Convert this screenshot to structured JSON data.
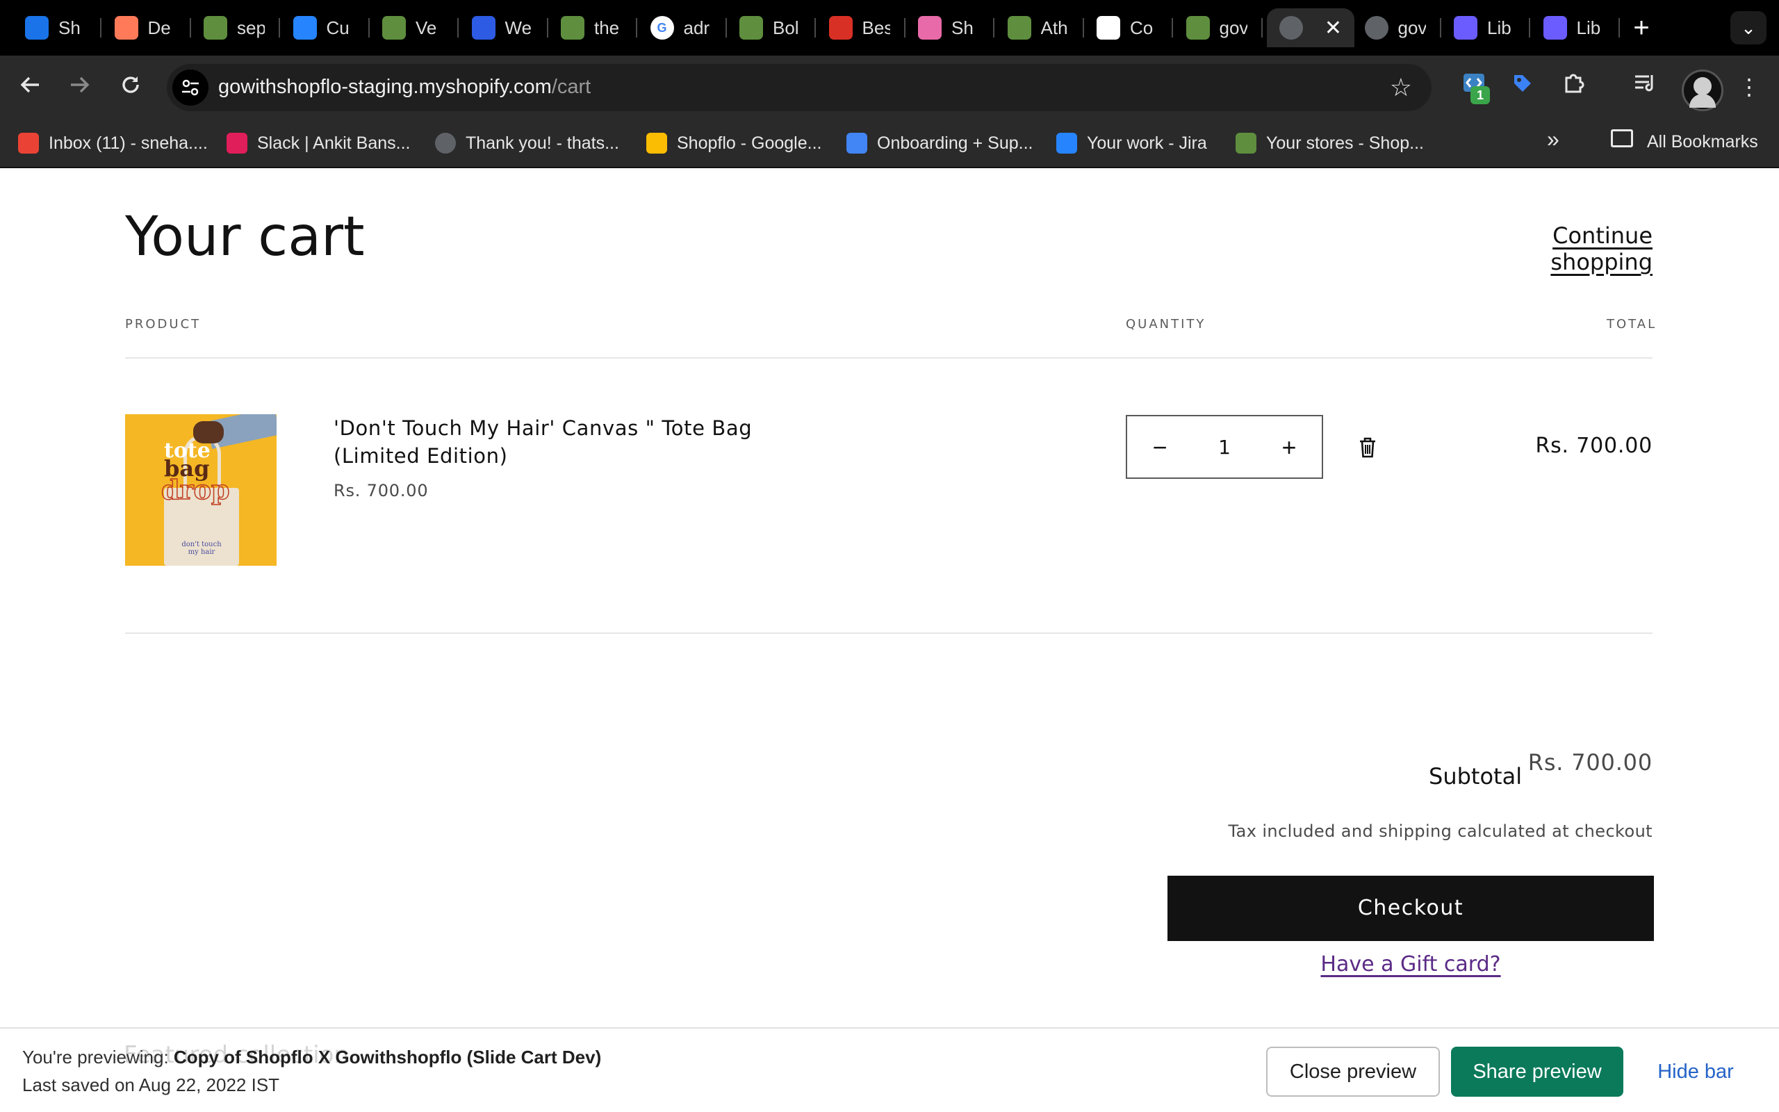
{
  "browser": {
    "tabs": [
      {
        "title": "Sh",
        "icon": "google-calendar-icon",
        "color": "#1a73e8"
      },
      {
        "title": "De",
        "icon": "hubspot-icon",
        "color": "#ff7a59"
      },
      {
        "title": "sep",
        "icon": "shopify-icon",
        "color": "#5e8e3e"
      },
      {
        "title": "Cu",
        "icon": "jira-icon",
        "color": "#2684ff"
      },
      {
        "title": "Ve",
        "icon": "shopify-icon",
        "color": "#5e8e3e"
      },
      {
        "title": "We",
        "icon": "webflow-icon",
        "color": "#2d5be3"
      },
      {
        "title": "the",
        "icon": "shopify-icon",
        "color": "#5e8e3e"
      },
      {
        "title": "adr",
        "icon": "google-icon",
        "color": "#ffffff"
      },
      {
        "title": "Bol",
        "icon": "shopify-icon",
        "color": "#5e8e3e"
      },
      {
        "title": "Bes",
        "icon": "red-circle-icon",
        "color": "#d93025"
      },
      {
        "title": "Sh",
        "icon": "shopping-bag-icon",
        "color": "#e86aa8"
      },
      {
        "title": "Ath",
        "icon": "shopify-icon",
        "color": "#5e8e3e"
      },
      {
        "title": "Co",
        "icon": "ticket-icon",
        "color": "#ffffff"
      },
      {
        "title": "gov",
        "icon": "shopify-icon",
        "color": "#5e8e3e"
      },
      {
        "title": "",
        "icon": "globe-icon",
        "color": "#5f6368",
        "active": true
      },
      {
        "title": "gov",
        "icon": "globe-icon",
        "color": "#5f6368"
      },
      {
        "title": "Lib",
        "icon": "asterisk-icon",
        "color": "#6a5cff"
      },
      {
        "title": "Lib",
        "icon": "asterisk-icon",
        "color": "#6a5cff"
      }
    ],
    "close_tab_glyph": "✕",
    "new_tab_glyph": "+",
    "tab_menu_glyph": "⌄",
    "url_host": "gowithshopflo-staging.myshopify.com",
    "url_path": "/cart",
    "extension_badge": "1",
    "bookmarks": [
      {
        "label": "Inbox (11) - sneha....",
        "icon": "gmail-icon",
        "color": "#ea4335"
      },
      {
        "label": "Slack | Ankit Bans...",
        "icon": "slack-icon",
        "color": "#e01e5a"
      },
      {
        "label": "Thank you! - thats...",
        "icon": "globe-icon",
        "color": "#5f6368"
      },
      {
        "label": "Shopflo - Google...",
        "icon": "google-drive-icon",
        "color": "#fbbc04"
      },
      {
        "label": "Onboarding + Sup...",
        "icon": "google-docs-icon",
        "color": "#4285f4"
      },
      {
        "label": "Your work - Jira",
        "icon": "jira-icon",
        "color": "#2684ff"
      },
      {
        "label": "Your stores - Shop...",
        "icon": "shopify-icon",
        "color": "#5e8e3e"
      }
    ],
    "more_bookmarks_glyph": "»",
    "all_bookmarks_label": "All Bookmarks"
  },
  "cart": {
    "title": "Your cart",
    "continue_shopping": "Continue shopping",
    "columns": {
      "product": "PRODUCT",
      "quantity": "QUANTITY",
      "total": "TOTAL"
    },
    "items": [
      {
        "name": "'Don't Touch My Hair' Canvas \" Tote Bag (Limited Edition)",
        "price": "Rs. 700.00",
        "quantity": "1",
        "line_total": "Rs. 700.00",
        "image_text": {
          "line1": "tote",
          "line2": "bag",
          "line3": "drop",
          "small": "don't touch my hair"
        }
      }
    ],
    "qty_minus": "−",
    "qty_plus": "+",
    "subtotal_label": "Subtotal",
    "subtotal_value": "Rs. 700.00",
    "tax_note": "Tax included and shipping calculated at checkout",
    "checkout_label": "Checkout",
    "gift_card_label": "Have a Gift card?"
  },
  "preview_bar": {
    "ghost_text": "Featured collection",
    "previewing_prefix": "You're previewing: ",
    "theme_name": "Copy of Shopflo X Gowithshopflo (Slide Cart Dev)",
    "last_saved": "Last saved on Aug 22, 2022 IST",
    "close_preview": "Close preview",
    "share_preview": "Share preview",
    "hide_bar": "Hide bar"
  },
  "colors": {
    "checkout_bg": "#121212",
    "share_button": "#0b7a5a",
    "hide_link": "#2463c7",
    "gift_link": "#5b2a86",
    "product_image_bg": "#f5b724"
  }
}
